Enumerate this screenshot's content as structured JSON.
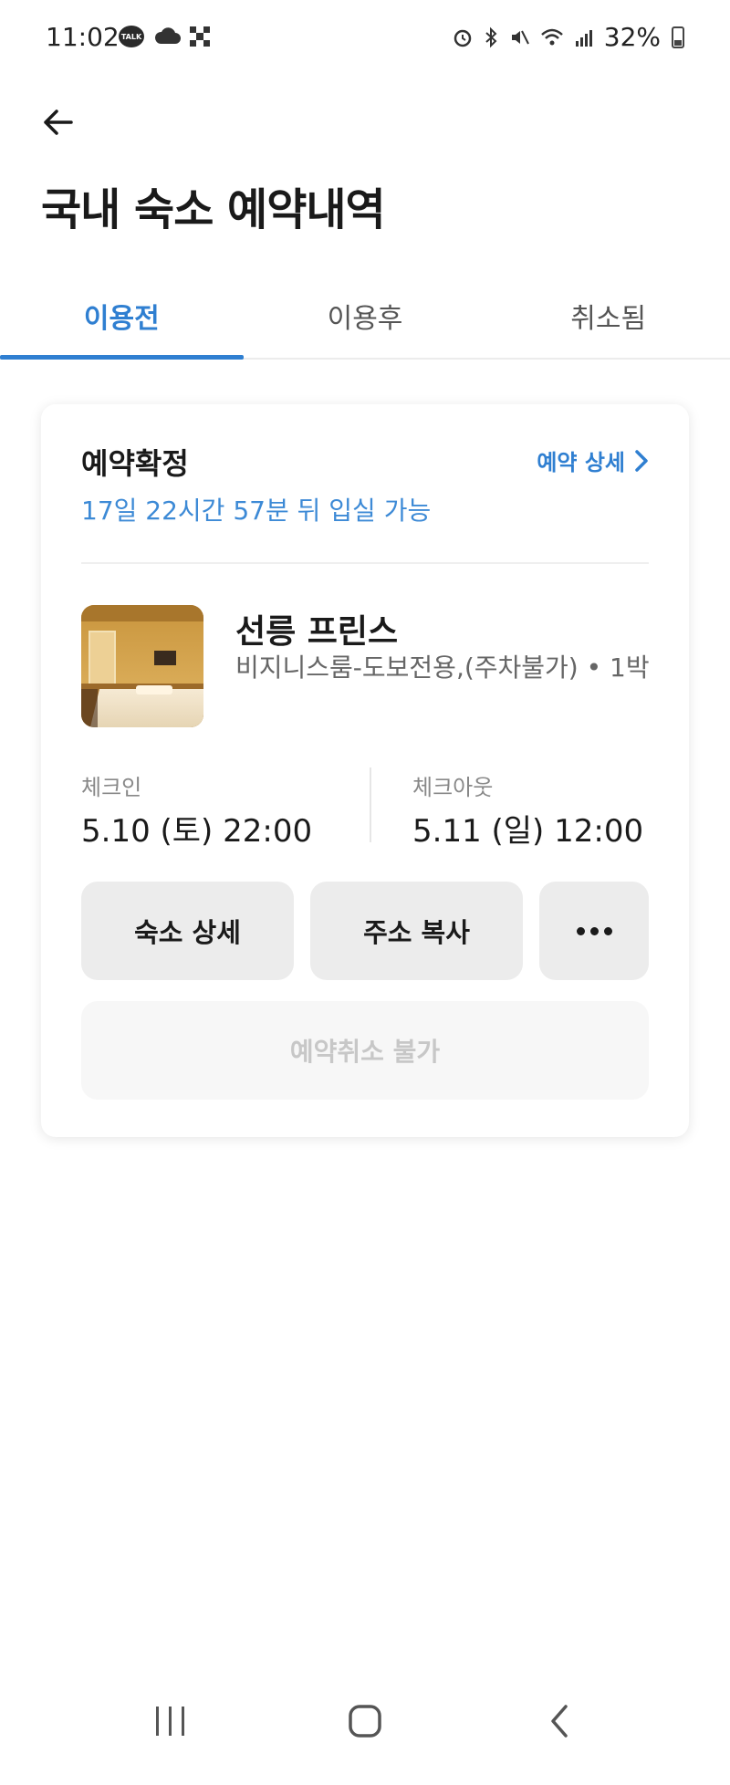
{
  "status_bar": {
    "time": "11:02",
    "talk_icon_text": "TALK",
    "battery": "32%",
    "icons_left": [
      "talk-icon",
      "cloud-icon",
      "grid-icon"
    ],
    "icons_right": [
      "alarm-icon",
      "bluetooth-icon",
      "mute-icon",
      "wifi-icon",
      "signal-icon",
      "battery-icon"
    ]
  },
  "header": {
    "back_icon": "arrow-left-icon",
    "title": "국내 숙소 예약내역"
  },
  "tabs": [
    {
      "label": "이용전",
      "active": true
    },
    {
      "label": "이용후",
      "active": false
    },
    {
      "label": "취소됨",
      "active": false
    }
  ],
  "reservation": {
    "status": "예약확정",
    "detail_link": "예약 상세",
    "countdown": "17일 22시간 57분 뒤 입실 가능",
    "hotel_name": "선릉 프린스",
    "room_info": "비지니스룸-도보전용,(주차불가) • 1박",
    "checkin_label": "체크인",
    "checkin_value": "5.10 (토) 22:00",
    "checkout_label": "체크아웃",
    "checkout_value": "5.11 (일) 12:00",
    "buttons": {
      "lodging_detail": "숙소 상세",
      "copy_address": "주소 복사",
      "more": "more-icon"
    },
    "cancel_label": "예약취소 불가"
  },
  "colors": {
    "accent": "#2f7fd1",
    "countdown": "#3d8ad6",
    "button_bg": "#ececec",
    "disabled_text": "#c7c7c7"
  },
  "nav_bar": [
    "recent-apps-icon",
    "home-icon",
    "back-icon"
  ]
}
